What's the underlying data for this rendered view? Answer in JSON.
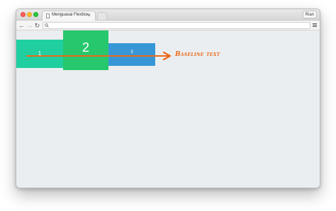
{
  "browser": {
    "tab_title": "Menguasai Flexbox",
    "tab_close_glyph": "×",
    "profile_name": "Rian",
    "address_value": "",
    "nav": {
      "back_glyph": "←",
      "forward_glyph": "→",
      "reload_glyph": "↻"
    }
  },
  "demo": {
    "items": [
      {
        "label": "1",
        "color": "#1fcf9f"
      },
      {
        "label": "2",
        "color": "#27c76d"
      },
      {
        "label": "3",
        "color": "#3797d6"
      }
    ],
    "annotation": {
      "text": "Baseline text",
      "color": "#e96a1c"
    }
  },
  "colors": {
    "viewport_bg": "#ebeef0",
    "traffic_close": "#ff5f57",
    "traffic_minimize": "#febc2e",
    "traffic_maximize": "#28c840"
  },
  "icons": {
    "tab": "page-icon",
    "address_bar": "search-icon",
    "menu": "hamburger-menu-icon",
    "annotation": "arrow-right-icon"
  }
}
